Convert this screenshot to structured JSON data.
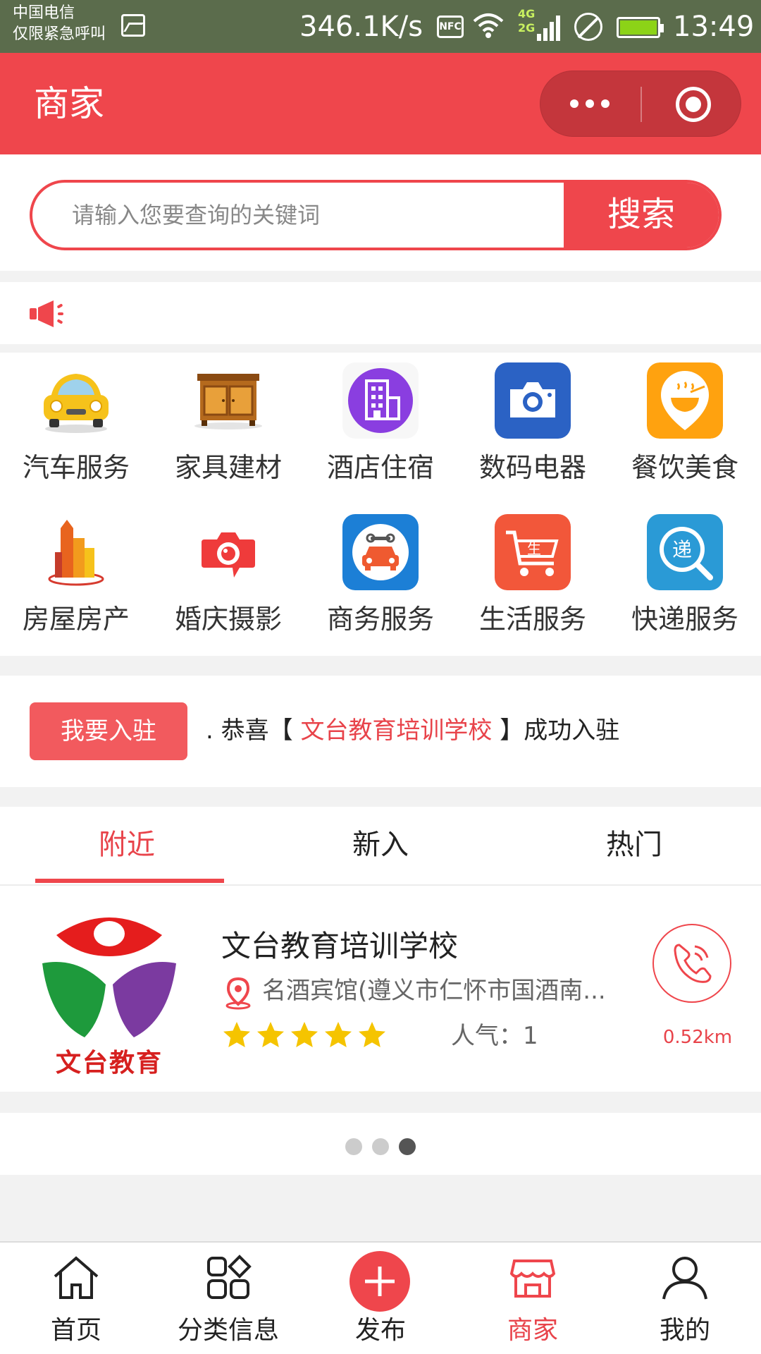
{
  "status_bar": {
    "carrier": "中国电信",
    "emergency": "仅限紧急呼叫",
    "speed": "346.1K/s",
    "nfc": "NFC",
    "network_4g": "4G",
    "network_2g": "2G",
    "time": "13:49"
  },
  "header": {
    "title": "商家"
  },
  "search": {
    "placeholder": "请输入您要查询的关键词",
    "button": "搜索"
  },
  "categories": [
    {
      "label": "汽车服务",
      "icon": "car-icon"
    },
    {
      "label": "家具建材",
      "icon": "cabinet-icon"
    },
    {
      "label": "酒店住宿",
      "icon": "hotel-building-icon"
    },
    {
      "label": "数码电器",
      "icon": "camera-icon"
    },
    {
      "label": "餐饮美食",
      "icon": "noodle-bowl-icon"
    },
    {
      "label": "房屋房产",
      "icon": "buildings-icon"
    },
    {
      "label": "婚庆摄影",
      "icon": "photo-camera-icon"
    },
    {
      "label": "商务服务",
      "icon": "car-repair-icon"
    },
    {
      "label": "生活服务",
      "icon": "shopping-cart-icon"
    },
    {
      "label": "快递服务",
      "icon": "express-icon"
    }
  ],
  "join": {
    "button": "我要入驻",
    "prefix": ". 恭喜【 ",
    "name": "文台教育培训学校",
    "suffix": " 】成功入驻"
  },
  "tabs": [
    {
      "label": "附近",
      "active": true
    },
    {
      "label": "新入",
      "active": false
    },
    {
      "label": "热门",
      "active": false
    }
  ],
  "merchant": {
    "name": "文台教育培训学校",
    "logo_text": "文台教育",
    "address": "名酒宾馆(遵义市仁怀市国酒南...",
    "rating": 5,
    "popularity": "人气：1",
    "distance": "0.52km"
  },
  "pager": {
    "count": 3,
    "active_index": 2
  },
  "tabbar": [
    {
      "label": "首页",
      "icon": "home-icon",
      "active": false
    },
    {
      "label": "分类信息",
      "icon": "category-grid-icon",
      "active": false
    },
    {
      "label": "发布",
      "icon": "plus-icon",
      "active": false
    },
    {
      "label": "商家",
      "icon": "store-icon",
      "active": true
    },
    {
      "label": "我的",
      "icon": "user-icon",
      "active": false
    }
  ],
  "colors": {
    "primary": "#ef464c",
    "star": "#f5c400",
    "status_bar": "#5b6c4c"
  }
}
